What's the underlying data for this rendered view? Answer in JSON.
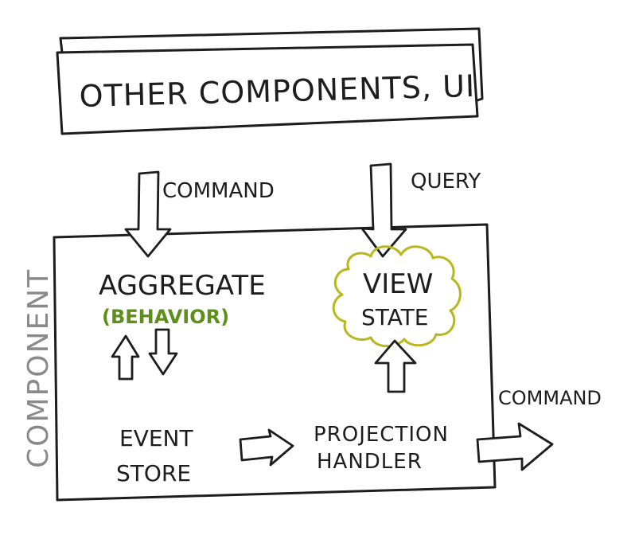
{
  "top_box": {
    "label": "OTHER COMPONENTS, UI"
  },
  "component_label": "COMPONENT",
  "incoming": {
    "command_label": "COMMAND",
    "query_label": "QUERY"
  },
  "outgoing": {
    "command_label": "COMMAND"
  },
  "aggregate": {
    "title": "AGGREGATE",
    "subtitle": "(BEHAVIOR)",
    "subtitle_color": "#5e8f1b"
  },
  "view_state": {
    "line1": "VIEW",
    "line2": "STATE",
    "outline_color": "#b8b81e"
  },
  "event_store": {
    "line1": "EVENT",
    "line2": "STORE"
  },
  "projection_handler": {
    "line1": "PROJECTION",
    "line2": "HANDLER"
  }
}
